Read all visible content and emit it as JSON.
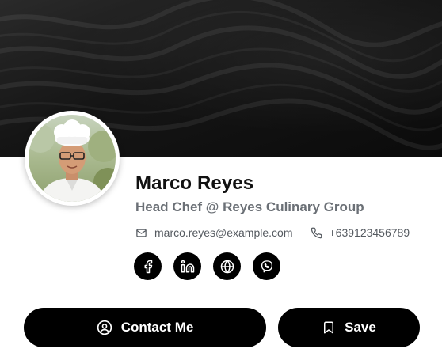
{
  "profile": {
    "name": "Marco Reyes",
    "title": "Head Chef @ Reyes Culinary Group",
    "email": "marco.reyes@example.com",
    "phone": "+639123456789"
  },
  "social_links": [
    {
      "network": "facebook",
      "icon": "facebook-icon"
    },
    {
      "network": "linkedin",
      "icon": "linkedin-icon"
    },
    {
      "network": "website",
      "icon": "globe-icon"
    },
    {
      "network": "viber",
      "icon": "viber-icon"
    }
  ],
  "actions": {
    "contact_label": "Contact Me",
    "save_label": "Save"
  },
  "colors": {
    "button_bg": "#000000",
    "button_text": "#ffffff",
    "title_text": "#6b7076"
  }
}
